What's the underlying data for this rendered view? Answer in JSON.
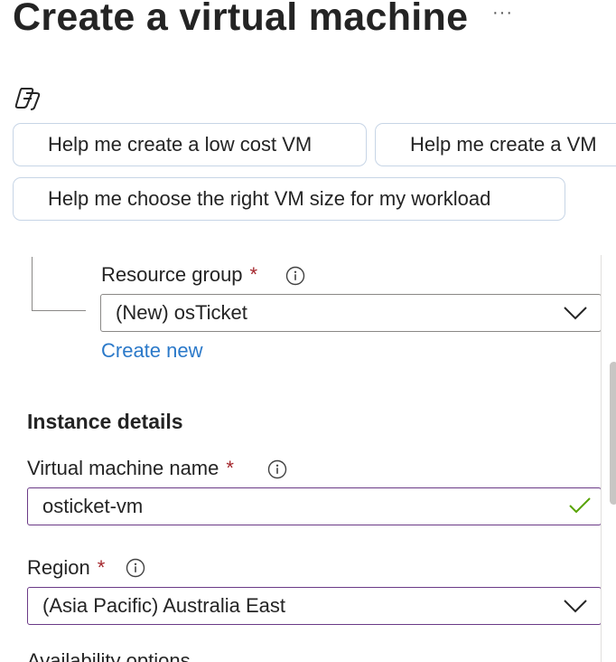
{
  "page": {
    "title": "Create a virtual machine",
    "more_label": "···"
  },
  "copilot": {
    "icon": "copilot-icon",
    "suggestions": [
      "Help me create a low cost VM",
      "Help me create a VM",
      "Help me choose the right VM size for my workload"
    ]
  },
  "resource_group": {
    "label": "Resource group",
    "required_mark": "*",
    "value": "(New) osTicket",
    "create_new_label": "Create new"
  },
  "instance_details": {
    "heading": "Instance details",
    "vm_name": {
      "label": "Virtual machine name",
      "required_mark": "*",
      "value": "osticket-vm"
    },
    "region": {
      "label": "Region",
      "required_mark": "*",
      "value": "(Asia Pacific) Australia East"
    },
    "availability_options_label": "Availability options"
  },
  "colors": {
    "link": "#2b79c9",
    "required": "#a4262c",
    "focus_border": "#6b3a87",
    "valid_check": "#57a300",
    "chip_border": "#c7d5e6"
  }
}
